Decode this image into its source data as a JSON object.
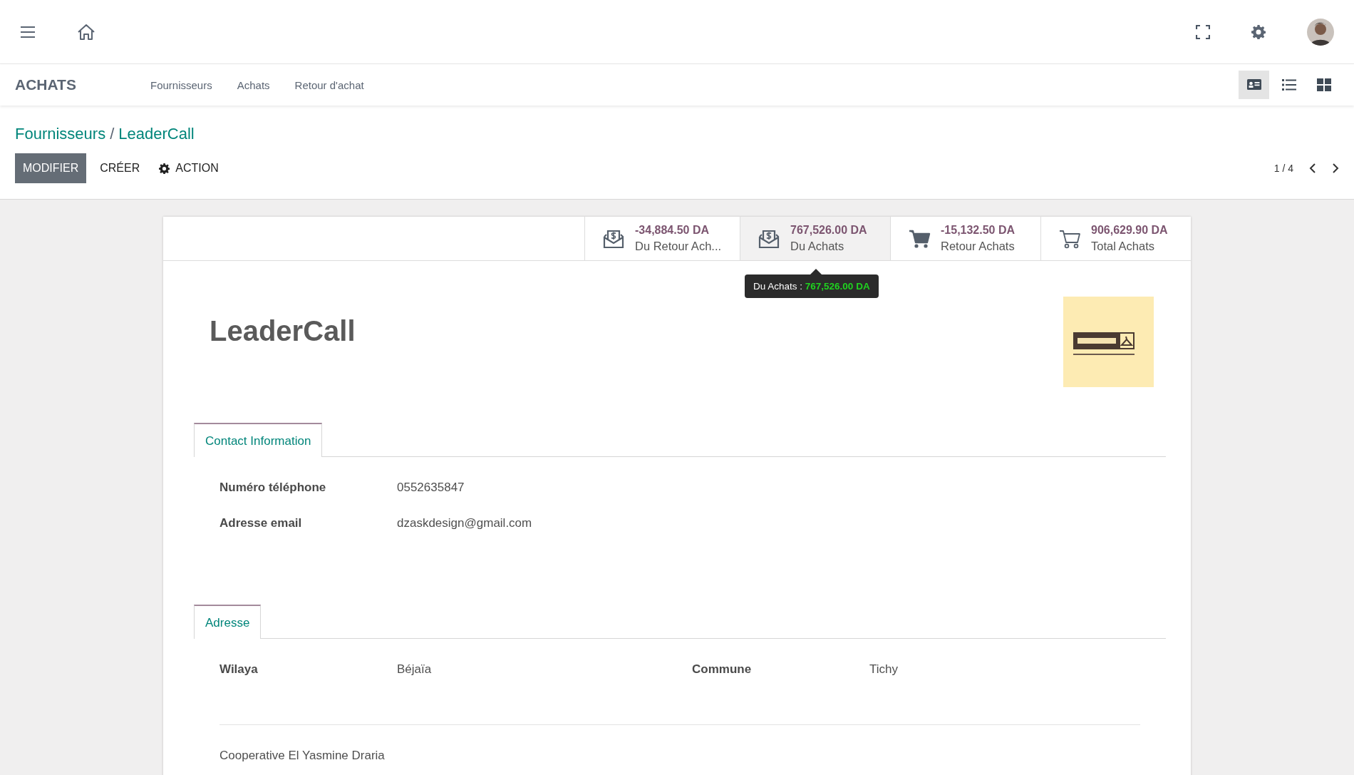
{
  "app_nav": {
    "title": "ACHATS",
    "menu": [
      "Fournisseurs",
      "Achats",
      "Retour d'achat"
    ],
    "views": [
      {
        "kind": "form",
        "selected": true
      },
      {
        "kind": "list",
        "selected": false
      },
      {
        "kind": "kanban",
        "selected": false
      }
    ]
  },
  "breadcrumb": {
    "parent": "Fournisseurs",
    "separator": "/",
    "current": "LeaderCall"
  },
  "buttons": {
    "edit": "MODIFIER",
    "create": "CRÉER",
    "action": "ACTION"
  },
  "pager": "1 / 4",
  "stat_buttons": [
    {
      "kind": "envelope",
      "value": "-34,884.50 DA",
      "label": "Du Retour Ach...",
      "hovered": false
    },
    {
      "kind": "envelope",
      "value": "767,526.00 DA",
      "label": "Du Achats",
      "hovered": true
    },
    {
      "kind": "cart-filled",
      "value": "-15,132.50 DA",
      "label": "Retour Achats",
      "hovered": false
    },
    {
      "kind": "cart-outline",
      "value": "906,629.90 DA",
      "label": "Total Achats",
      "hovered": false
    }
  ],
  "tooltip": {
    "label": "Du Achats :",
    "value": "767,526.00 DA"
  },
  "record": {
    "name": "LeaderCall"
  },
  "tabs": [
    {
      "label": "Contact Information",
      "selected": true,
      "fields": [
        {
          "label": "Numéro téléphone",
          "value": "0552635847"
        },
        {
          "label": "Adresse email",
          "value": "dzaskdesign@gmail.com"
        }
      ]
    },
    {
      "label": "Adresse",
      "selected": true,
      "fields": [
        {
          "label": "Wilaya",
          "value": "Béjaïa"
        },
        {
          "label": "Commune",
          "value": "Tichy"
        }
      ],
      "note": "Cooperative El Yasmine Draria"
    }
  ]
}
